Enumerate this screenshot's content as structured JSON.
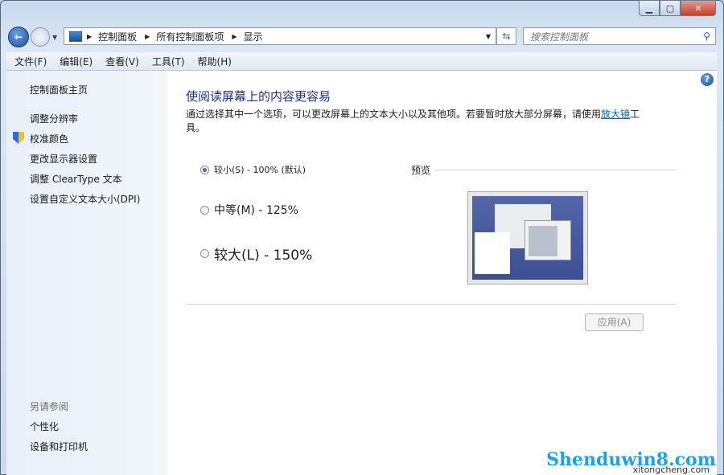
{
  "window": {
    "minimize_icon": "minimize-icon",
    "maximize_icon": "maximize-icon",
    "close_icon": "close-icon"
  },
  "nav": {
    "breadcrumbs": [
      "控制面板",
      "所有控制面板项",
      "显示"
    ],
    "search_placeholder": "搜索控制面板"
  },
  "menu": [
    "文件(F)",
    "编辑(E)",
    "查看(V)",
    "工具(T)",
    "帮助(H)"
  ],
  "sidebar": {
    "home": "控制面板主页",
    "items": [
      "调整分辨率",
      "校准颜色",
      "更改显示器设置",
      "调整 ClearType 文本",
      "设置自定义文本大小(DPI)"
    ],
    "see_also": "另请参阅",
    "see_also_items": [
      "个性化",
      "设备和打印机"
    ]
  },
  "main": {
    "title": "使阅读屏幕上的内容更容易",
    "desc_before": "通过选择其中一个选项，可以更改屏幕上的文本大小以及其他项。若要暂时放大部分屏幕，请使用",
    "desc_link": "放大镜",
    "desc_after": "工具。",
    "options": [
      {
        "label": "较小(S) - 100% (默认)",
        "selected": true
      },
      {
        "label": "中等(M) - 125%",
        "selected": false
      },
      {
        "label": "较大(L) - 150%",
        "selected": false
      }
    ],
    "preview_label": "预览",
    "apply_label": "应用(A)"
  },
  "watermark": {
    "text": "Shenduwin8.com",
    "sub": "xitongcheng.com"
  }
}
